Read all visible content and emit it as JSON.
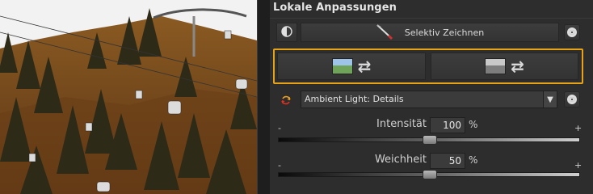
{
  "panel": {
    "title": "Lokale Anpassungen",
    "selective_draw_label": "Selektiv Zeichnen"
  },
  "preset": {
    "selected": "Ambient Light: Details"
  },
  "sliders": [
    {
      "label": "Intensität",
      "value": "100",
      "unit": "%",
      "min_label": "-",
      "max_label": "+",
      "level": 0.5
    },
    {
      "label": "Weichheit",
      "value": "50",
      "unit": "%",
      "min_label": "-",
      "max_label": "+",
      "level": 0.5
    }
  ],
  "icons": {
    "mask_toggle": "half-circle-icon",
    "brush": "brush-icon",
    "visibility": "eye-icon",
    "reset": "swap-arrows-icon",
    "preset": "cycle-icon",
    "dropdown": "triangle-down-icon"
  },
  "colors": {
    "highlight": "#e6a317",
    "panel_bg": "#2d2d2d"
  }
}
